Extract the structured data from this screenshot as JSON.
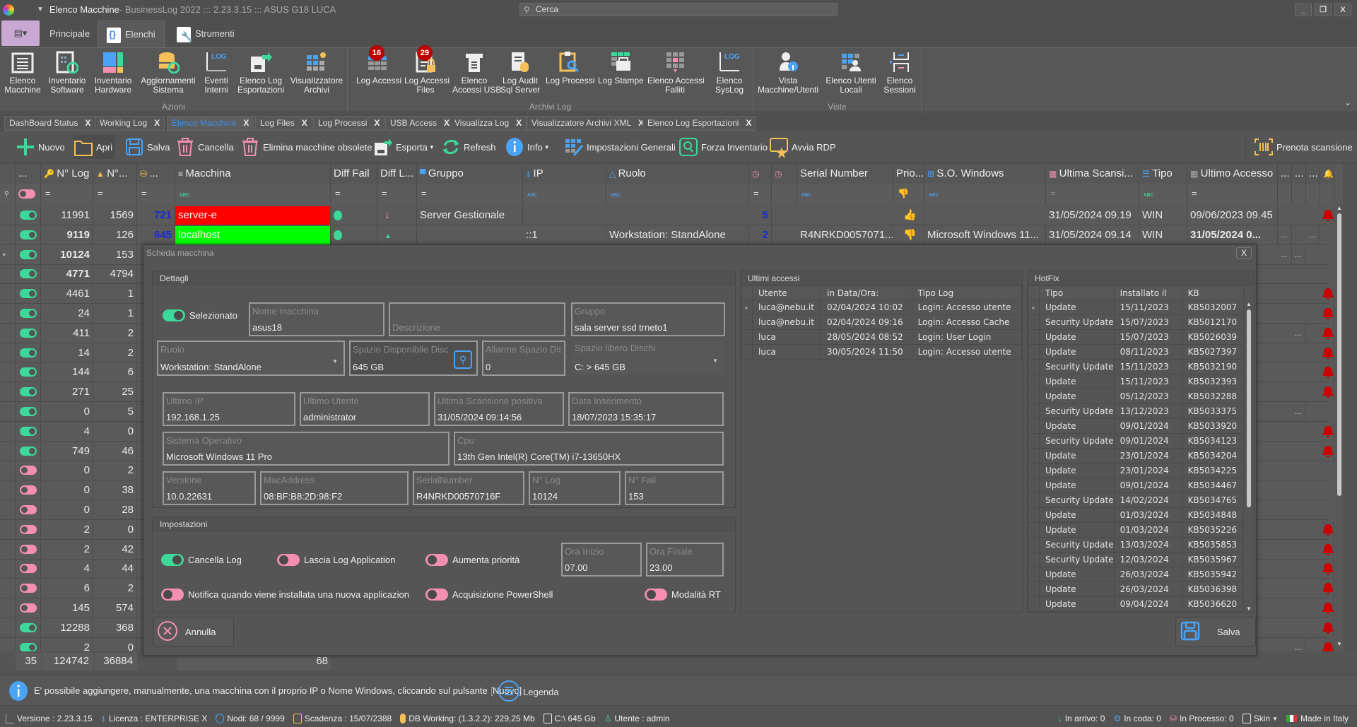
{
  "window": {
    "title_main": "Elenco Macchine",
    "title_sub": " - BusinessLog 2022 ::: 2.23.3.15 ::: ASUS G18 LUCA",
    "search_placeholder": "Cerca",
    "controls": {
      "minimize": "_",
      "restore": "❐",
      "close": "X"
    }
  },
  "ribbon_tabs": [
    {
      "label": "Principale",
      "icon": "home-icon"
    },
    {
      "label": "Elenchi",
      "icon": "list-icon",
      "active": true
    },
    {
      "label": "Strumenti",
      "icon": "tools-icon"
    }
  ],
  "ribbon": {
    "groups": [
      {
        "label": "Azioni",
        "buttons": [
          {
            "label": "Elenco\nMacchine",
            "icon": "list-icon"
          },
          {
            "label": "Inventario\nSoftware",
            "icon": "software-inventory-icon"
          },
          {
            "label": "Inventario\nHardware",
            "icon": "hardware-inventory-icon"
          },
          {
            "label": "Aggiornamenti\nSistema",
            "icon": "database-refresh-icon"
          },
          {
            "label": "Eventi\nInterni",
            "icon": "log-icon"
          },
          {
            "label": "Elenco Log\nEsportazioni",
            "icon": "export-icon"
          },
          {
            "label": "Visualizzatore\nArchivi",
            "icon": "archive-viewer-icon"
          }
        ]
      },
      {
        "label": "Archivi Log",
        "buttons": [
          {
            "label": "Log Accessi",
            "icon": "grid-icon",
            "badge": "16"
          },
          {
            "label": "Log Accessi\nFiles",
            "icon": "file-lock-icon",
            "badge": "29"
          },
          {
            "label": "Elenco\nAccessi USB",
            "icon": "usb-icon"
          },
          {
            "label": "Log Audit\nSql Server",
            "icon": "sql-audit-icon"
          },
          {
            "label": "Log Processi",
            "icon": "clipboard-search-icon"
          },
          {
            "label": "Log Stampe",
            "icon": "printer-icon"
          },
          {
            "label": "Elenco Accessi\nFalliti",
            "icon": "failed-access-icon"
          },
          {
            "label": "Elenco\nSysLog",
            "icon": "syslog-icon"
          }
        ]
      },
      {
        "label": "Viste",
        "buttons": [
          {
            "label": "Vista\nMacchine/Utenti",
            "icon": "user-info-icon"
          },
          {
            "label": "Elenco Utenti\nLocali",
            "icon": "local-users-icon"
          },
          {
            "label": "Elenco\nSessioni",
            "icon": "sessions-icon"
          }
        ]
      }
    ]
  },
  "doc_tabs": [
    {
      "label": "DashBoard Status"
    },
    {
      "label": "Working Log"
    },
    {
      "label": "Elenco Macchine",
      "active": true
    },
    {
      "label": "Log Files"
    },
    {
      "label": "Log Processi"
    },
    {
      "label": "USB Access"
    },
    {
      "label": "Visualizza Log"
    },
    {
      "label": "Visualizzatore Archivi XML"
    },
    {
      "label": "Elenco Log Esportazioni"
    }
  ],
  "toolbar": {
    "nuovo": "Nuovo",
    "apri": "Apri",
    "salva": "Salva",
    "cancella": "Cancella",
    "elimina": "Elimina macchine obsolete",
    "esporta": "Esporta",
    "refresh": "Refresh",
    "info": "Info",
    "impostazioni": "Impostazioni Generali",
    "forza": "Forza Inventario",
    "rdp": "Avvia RDP",
    "prenota": "Prenota scansione"
  },
  "grid": {
    "columns": [
      "...",
      "N° Log",
      "N°...",
      "...",
      "Macchina",
      "Diff Fail",
      "Diff L...",
      "Gruppo",
      "IP",
      "Ruolo",
      "",
      "",
      "Serial Number",
      "Prio...",
      "S.O. Windows",
      "Ultima Scansi...",
      "Tipo",
      "Ultimo Accesso",
      "...",
      "...",
      "...",
      ""
    ],
    "filter_symbol": "=",
    "rows": [
      {
        "sel": true,
        "nlog": "11991",
        "nfail": "1569",
        "n3": "721",
        "macchina": "server-e",
        "mcolor": "#ff0000",
        "diffl": "down",
        "gruppo": "Server Gestionale",
        "ip": "",
        "ruolo": "",
        "c1": "5",
        "serial": "",
        "prio": "up",
        "os": "",
        "scan": "31/05/2024 09.19",
        "tipo": "WIN",
        "acc": "09/06/2023 09.45",
        "bell": true
      },
      {
        "sel": true,
        "nlog": "9119",
        "bold": true,
        "nfail": "126",
        "n3": "645",
        "macchina": "localhost",
        "mcolor": "#00ff00",
        "diffl": "up",
        "gruppo": "",
        "ip": "::1",
        "ruolo": "Workstation: StandAlone",
        "c1": "2",
        "serial": "R4NRKD0057071...",
        "prio": "down",
        "os": "Microsoft Windows 11...",
        "scan": "31/05/2024 09.14",
        "tipo": "WIN",
        "acc": "31/05/2024 0...",
        "accbold": true,
        "e1": "...",
        "e3": "..."
      },
      {
        "sel": true,
        "nlog": "10124",
        "bold": true,
        "nfail": "153",
        "current": true,
        "e1": "...",
        "e2": "..."
      },
      {
        "sel": true,
        "nlog": "4771",
        "bold": true,
        "nfail": "4794"
      },
      {
        "sel": true,
        "nlog": "4461",
        "nfail": "1",
        "bell": true
      },
      {
        "sel": true,
        "nlog": "24",
        "nfail": "1",
        "bell": true
      },
      {
        "sel": true,
        "nlog": "411",
        "nfail": "2",
        "e2": "...",
        "bell": true
      },
      {
        "sel": true,
        "nlog": "14",
        "nfail": "2",
        "bell": true
      },
      {
        "sel": true,
        "nlog": "144",
        "nfail": "6",
        "bell": true
      },
      {
        "sel": true,
        "nlog": "271",
        "nfail": "25",
        "bell": true
      },
      {
        "sel": true,
        "nlog": "0",
        "nfail": "5",
        "e2": "..."
      },
      {
        "sel": true,
        "nlog": "4",
        "nfail": "0",
        "bell": true
      },
      {
        "sel": true,
        "nlog": "749",
        "nfail": "46",
        "bell": true
      },
      {
        "sel": false,
        "nlog": "0",
        "nfail": "2"
      },
      {
        "sel": false,
        "nlog": "0",
        "nfail": "38"
      },
      {
        "sel": false,
        "nlog": "0",
        "nfail": "28"
      },
      {
        "sel": false,
        "nlog": "2",
        "nfail": "0",
        "bell": true
      },
      {
        "sel": false,
        "nlog": "2",
        "nfail": "42",
        "bell": true
      },
      {
        "sel": false,
        "nlog": "4",
        "nfail": "44",
        "bell": true
      },
      {
        "sel": false,
        "nlog": "6",
        "nfail": "2",
        "bell": true
      },
      {
        "sel": false,
        "nlog": "145",
        "nfail": "574",
        "bell": true
      },
      {
        "sel": true,
        "nlog": "12288",
        "nfail": "368",
        "bell": true
      },
      {
        "sel": true,
        "nlog": "2",
        "nfail": "0",
        "e2": "...",
        "bell": true
      }
    ],
    "footer": {
      "count": "35",
      "nlog": "124742",
      "nfail": "36884",
      "c1": "68"
    }
  },
  "modal": {
    "title": "Scheda macchina",
    "close": "X",
    "dettagli": {
      "title": "Dettagli",
      "selezionato": {
        "label": "Selezionato",
        "on": true
      },
      "nome_macchina": {
        "label": "Nome macchina",
        "value": "asus18"
      },
      "descrizione": {
        "label": "Descrizione",
        "value": ""
      },
      "gruppo": {
        "label": "Gruppo",
        "value": "sala server ssd trneto1"
      },
      "ruolo": {
        "label": "Ruolo",
        "value": "Workstation: StandAlone"
      },
      "spazio_disp": {
        "label": "Spazio Disponibile Disco",
        "value": "645 GB"
      },
      "allarme": {
        "label": "Allarme Spazio Disco",
        "value": "0"
      },
      "spazio_libero": {
        "label": "Spazio libero Dischi",
        "value": "C: > 645 GB"
      },
      "ultimo_ip": {
        "label": "Ultimo IP",
        "value": "192.168.1.25"
      },
      "ultimo_utente": {
        "label": "Ultimo Utente",
        "value": "administrator"
      },
      "ultima_scansione": {
        "label": "Ultima Scansione positiva",
        "value": "31/05/2024 09:14:56"
      },
      "data_inserimento": {
        "label": "Data Inserimento",
        "value": "18/07/2023 15:35:17"
      },
      "sistema_operativo": {
        "label": "Sistema Operativo",
        "value": "Microsoft Windows 11 Pro"
      },
      "cpu": {
        "label": "Cpu",
        "value": "13th Gen Intel(R) Core(TM) i7-13650HX"
      },
      "versione": {
        "label": "Versione",
        "value": "10.0.22631"
      },
      "mac": {
        "label": "MacAddress",
        "value": "08:BF:B8:2D:98:F2"
      },
      "serial": {
        "label": "SerialNumber",
        "value": "R4NRKD00570716F"
      },
      "nlog": {
        "label": "N° Log",
        "value": "10124"
      },
      "nfail": {
        "label": "N° Fail",
        "value": "153"
      }
    },
    "impostazioni": {
      "title": "Impostazioni",
      "cancella_log": {
        "label": "Cancella Log",
        "on": true
      },
      "lascia_log": {
        "label": "Lascia Log Application",
        "on": false
      },
      "aumenta": {
        "label": "Aumenta priorità",
        "on": false
      },
      "ora_inizio": {
        "label": "Ora Inizio",
        "value": "07.00"
      },
      "ora_finale": {
        "label": "Ora Finale",
        "value": "23.00"
      },
      "notifica": {
        "label": "Notifica quando viene installata una nuova applicazion",
        "on": false
      },
      "powershell": {
        "label": "Acquisizione PowerShell",
        "on": false
      },
      "rt": {
        "label": "Modalità RT",
        "on": false
      }
    },
    "annulla": "Annulla",
    "salva": "Salva",
    "accessi": {
      "title": "Ultimi accessi",
      "headers": [
        "Utente",
        "in Data/Ora:",
        "Tipo Log"
      ],
      "rows": [
        [
          "luca@nebu.it",
          "02/04/2024 10:02",
          "Login: Accesso utente"
        ],
        [
          "luca@nebu.it",
          "02/04/2024 09:16",
          "Login: Accesso Cache"
        ],
        [
          "luca",
          "28/05/2024 08:52",
          "Login: User Login"
        ],
        [
          "luca",
          "30/05/2024 11:50",
          "Login: Accesso utente"
        ]
      ]
    },
    "hotfix": {
      "title": "HotFix",
      "headers": [
        "Tipo",
        "Installato il",
        "KB"
      ],
      "rows": [
        [
          "Update",
          "15/11/2023",
          "KB5032007"
        ],
        [
          "Security Update",
          "15/07/2023",
          "KB5012170"
        ],
        [
          "Update",
          "15/07/2023",
          "KB5026039"
        ],
        [
          "Update",
          "08/11/2023",
          "KB5027397"
        ],
        [
          "Security Update",
          "15/11/2023",
          "KB5032190"
        ],
        [
          "Update",
          "15/11/2023",
          "KB5032393"
        ],
        [
          "Update",
          "05/12/2023",
          "KB5032288"
        ],
        [
          "Security Update",
          "13/12/2023",
          "KB5033375"
        ],
        [
          "Update",
          "09/01/2024",
          "KB5033920"
        ],
        [
          "Security Update",
          "09/01/2024",
          "KB5034123"
        ],
        [
          "Update",
          "23/01/2024",
          "KB5034204"
        ],
        [
          "Update",
          "23/01/2024",
          "KB5034225"
        ],
        [
          "Update",
          "09/01/2024",
          "KB5034467"
        ],
        [
          "Security Update",
          "14/02/2024",
          "KB5034765"
        ],
        [
          "Update",
          "01/03/2024",
          "KB5034848"
        ],
        [
          "Update",
          "01/03/2024",
          "KB5035226"
        ],
        [
          "Security Update",
          "13/03/2024",
          "KB5035853"
        ],
        [
          "Security Update",
          "12/03/2024",
          "KB5035967"
        ],
        [
          "Update",
          "26/03/2024",
          "KB5035942"
        ],
        [
          "Update",
          "26/03/2024",
          "KB5036398"
        ],
        [
          "Update",
          "09/04/2024",
          "KB5036620"
        ]
      ]
    }
  },
  "infobar": {
    "message": "E' possibile aggiungere, manualmente, una macchina con il proprio IP o Nome Windows, cliccando sul pulsante [Nuovo]",
    "legenda": "Legenda"
  },
  "status": {
    "versione": "Versione : 2.23.3.15",
    "licenza": "Licenza : ENTERPRISE X",
    "nodi": "Nodi: 68 / 9999",
    "scadenza": "Scadenza : 15/07/2388",
    "db": "DB Working: (1.3.2.2): 229,25 Mb",
    "disk": "C:\\ 645 Gb",
    "utente": "Utente : admin",
    "arrivo": "In arrivo: 0",
    "coda": "In coda: 0",
    "processo": "In Processo: 0",
    "skin": "Skin",
    "made": "Made in Italy"
  },
  "colors": {
    "accent_blue": "#3a8fe6",
    "green": "#3dd99a",
    "pink": "#f48fb1",
    "alarm_red": "#cc0000",
    "yellow": "#f5c05a"
  }
}
